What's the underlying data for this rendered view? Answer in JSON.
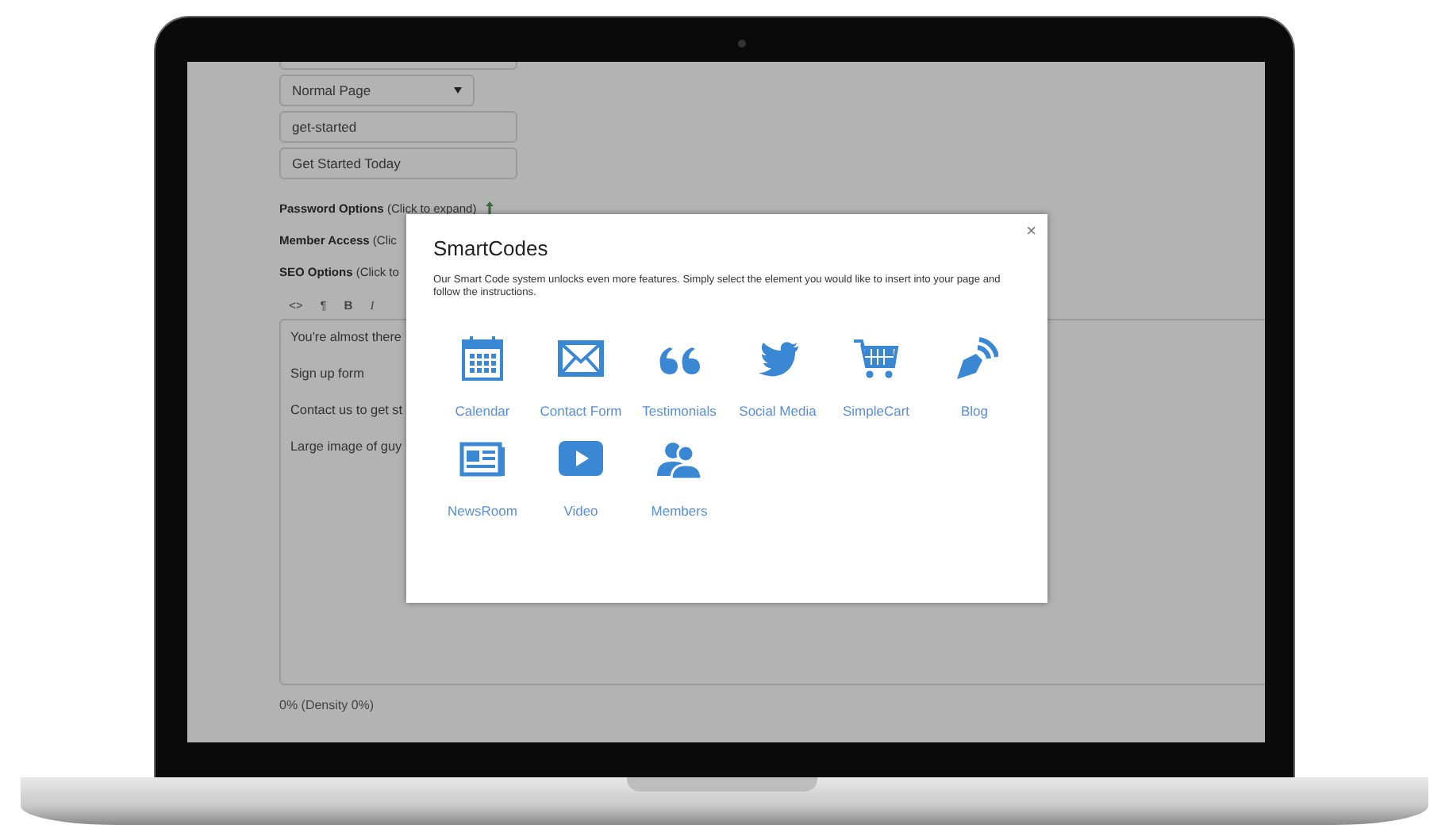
{
  "page_form": {
    "page_type_select": "Normal Page",
    "slug_field": "get-started",
    "title_field": "Get Started Today",
    "options": [
      {
        "label": "Password Options",
        "hint": "(Click to expand)",
        "kind": "with-icon"
      },
      {
        "label": "Member Access",
        "hint": "(Clic",
        "kind": "plain"
      },
      {
        "label": "SEO Options",
        "hint": "(Click to",
        "kind": "plain"
      }
    ],
    "editor_toolbar": [
      {
        "label": "<>",
        "kind": "code"
      },
      {
        "label": "¶",
        "kind": "paragraph"
      },
      {
        "label": "B",
        "kind": "bold"
      },
      {
        "label": "I",
        "kind": "italic"
      }
    ],
    "editor_lines": [
      "You're almost there",
      "Sign up form",
      "Contact us to get st",
      "Large image of guy"
    ],
    "density": "0% (Density 0%)"
  },
  "modal": {
    "title": "SmartCodes",
    "close": "×",
    "description": "Our Smart Code system unlocks even more features. Simply select the element you would like to insert into your page and follow the instructions.",
    "items": [
      {
        "label": "Calendar",
        "kind": "calendar"
      },
      {
        "label": "Contact Form",
        "kind": "envelope"
      },
      {
        "label": "Testimonials",
        "kind": "quote"
      },
      {
        "label": "Social Media",
        "kind": "bird"
      },
      {
        "label": "SimpleCart",
        "kind": "cart"
      },
      {
        "label": "Blog",
        "kind": "pen"
      },
      {
        "label": "NewsRoom",
        "kind": "newspaper"
      },
      {
        "label": "Video",
        "kind": "play"
      },
      {
        "label": "Members",
        "kind": "people"
      }
    ]
  }
}
